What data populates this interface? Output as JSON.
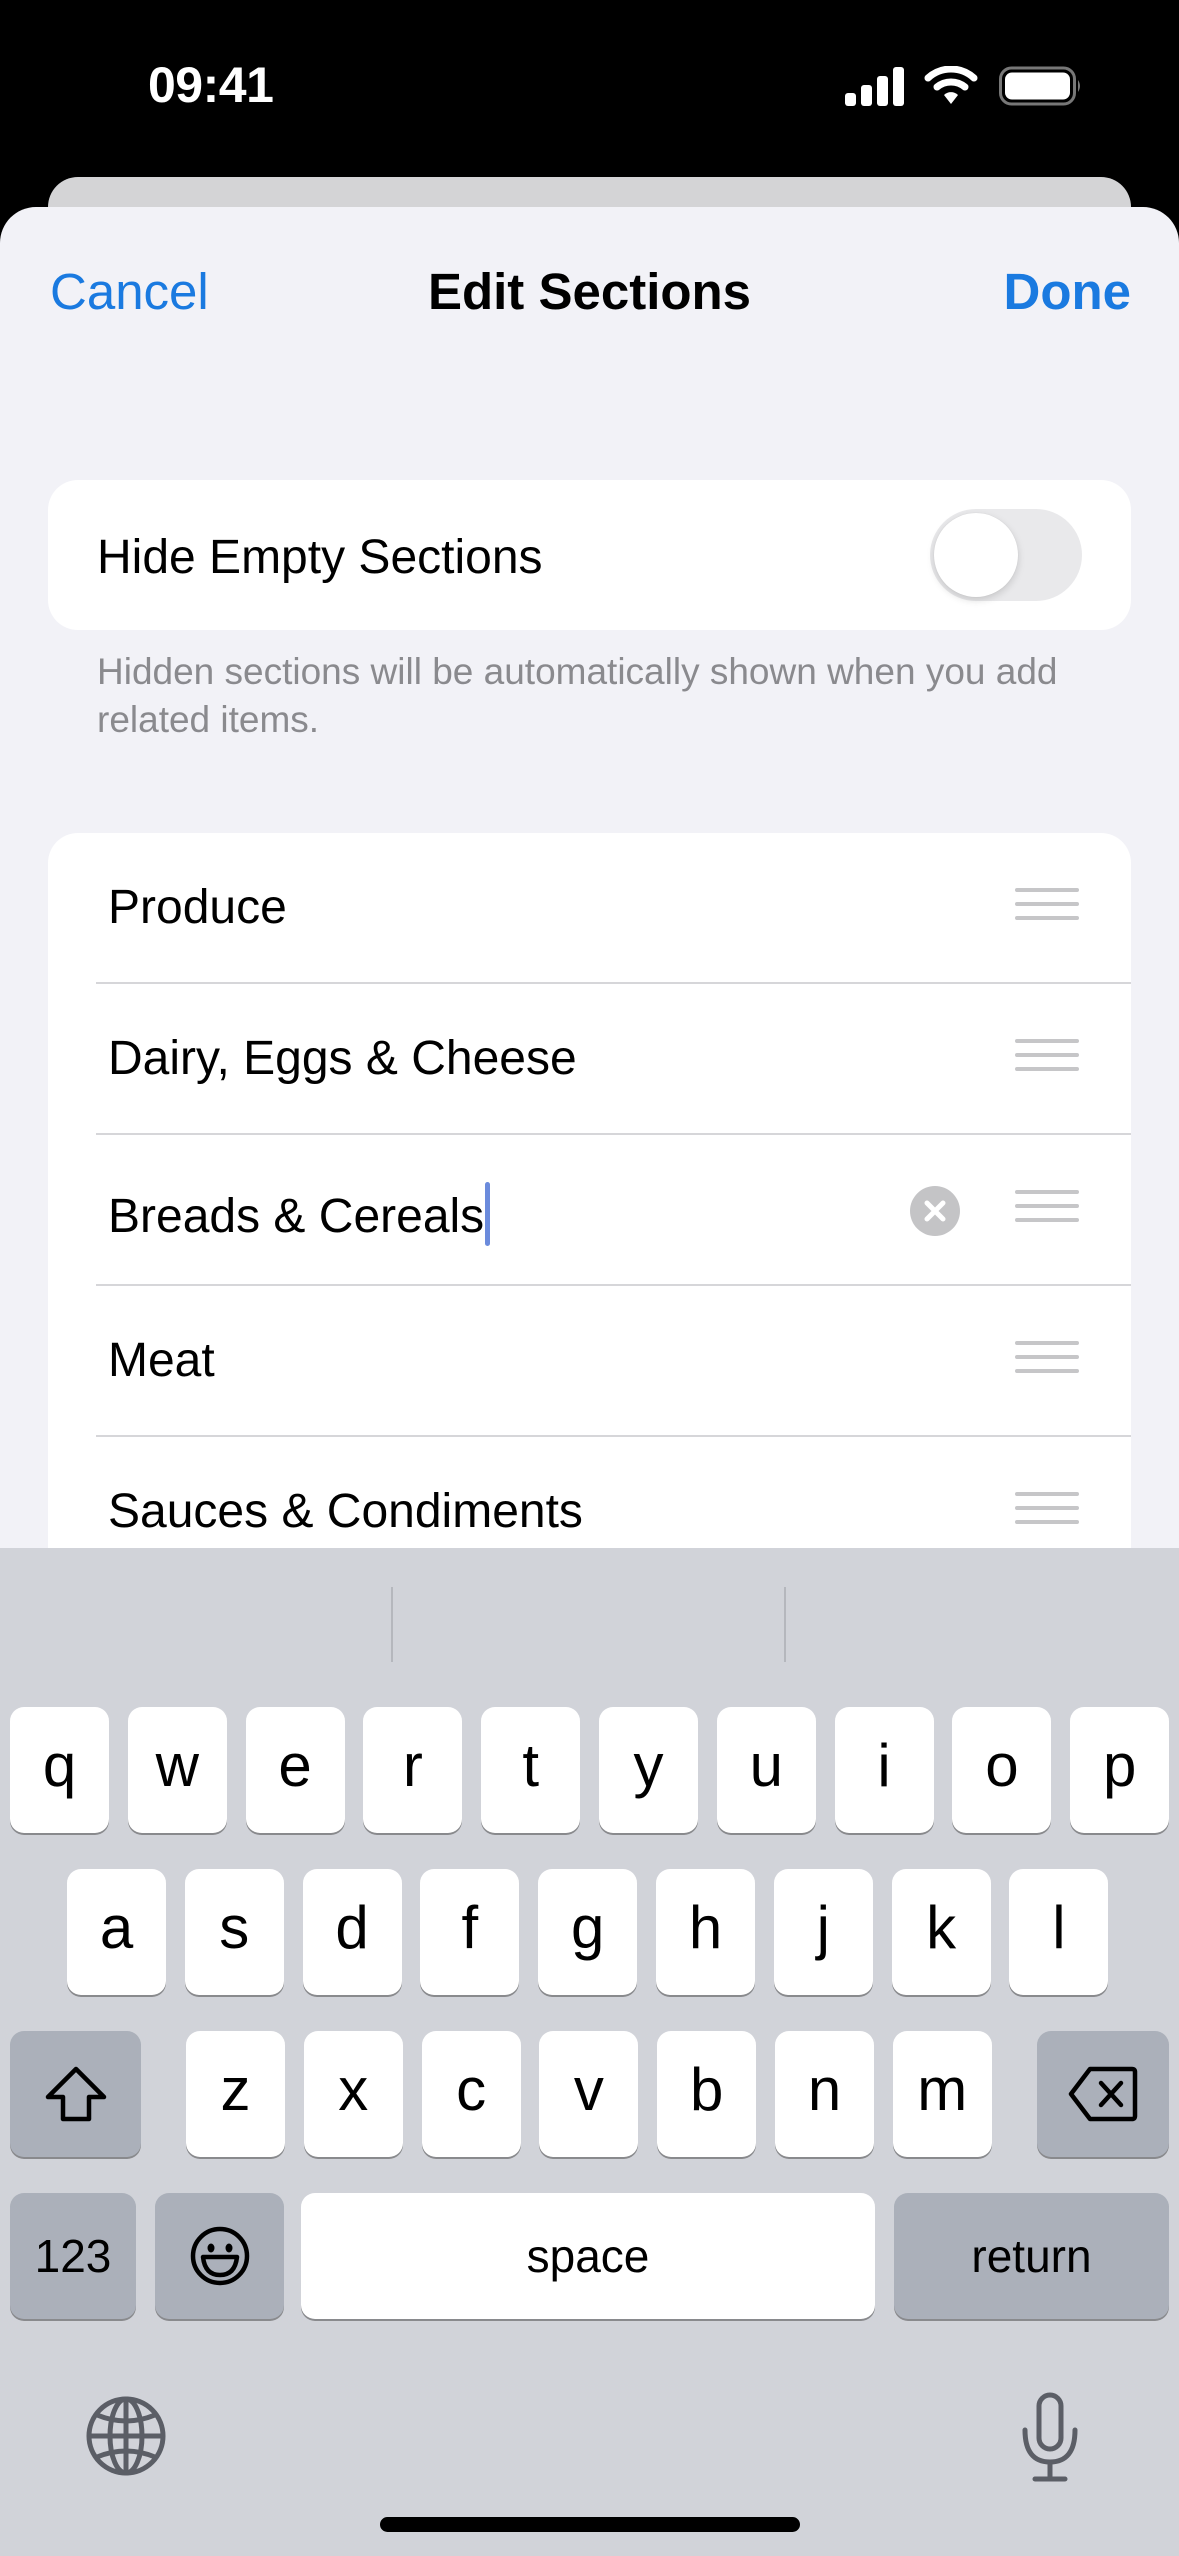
{
  "status_bar": {
    "time": "09:41",
    "icons": [
      "cellular-signal-icon",
      "wifi-icon",
      "battery-icon"
    ]
  },
  "colors": {
    "accent": "#1a7ae0",
    "sheet_background": "#f2f2f7",
    "keyboard_background": "#d1d3d9",
    "cursor": "#6b8bdc"
  },
  "nav": {
    "cancel_label": "Cancel",
    "title": "Edit Sections",
    "done_label": "Done"
  },
  "hide_empty": {
    "label": "Hide Empty Sections",
    "enabled": false,
    "footer": "Hidden sections will be automatically shown when you add related items."
  },
  "sections": [
    {
      "name": "Produce",
      "editing": false
    },
    {
      "name": "Dairy, Eggs & Cheese",
      "editing": false
    },
    {
      "name": "Breads & Cereals",
      "editing": true
    },
    {
      "name": "Meat",
      "editing": false
    },
    {
      "name": "Sauces & Condiments",
      "editing": false
    }
  ],
  "keyboard": {
    "predictions": [
      "",
      "",
      ""
    ],
    "row1": [
      "q",
      "w",
      "e",
      "r",
      "t",
      "y",
      "u",
      "i",
      "o",
      "p"
    ],
    "row2": [
      "a",
      "s",
      "d",
      "f",
      "g",
      "h",
      "j",
      "k",
      "l"
    ],
    "row3": [
      "z",
      "x",
      "c",
      "v",
      "b",
      "n",
      "m"
    ],
    "shift_icon": "shift-icon",
    "delete_icon": "delete-icon",
    "numbers_label": "123",
    "emoji_icon": "emoji-icon",
    "space_label": "space",
    "return_label": "return",
    "globe_icon": "globe-icon",
    "mic_icon": "microphone-icon"
  }
}
